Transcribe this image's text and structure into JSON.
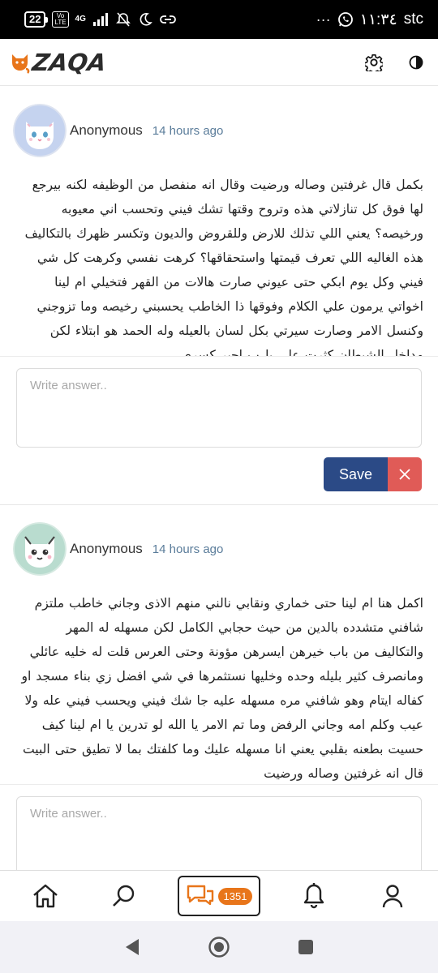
{
  "status_bar": {
    "battery": "22",
    "network": "4G",
    "time": "١١:٣٤",
    "carrier": "stc",
    "dots": "···"
  },
  "app": {
    "logo_text": "ZAQA",
    "brand_color": "#e8751a"
  },
  "posts": [
    {
      "author": "Anonymous",
      "time": "14 hours ago",
      "body": "بكمل قال غرفتين وصاله ورضيت وقال انه منفصل من الوظيفه لكنه بيرجع لها فوق كل تنازلاتي هذه وتروح وقتها تشك فيني وتحسب اني معيوبه ورخيصه؟ يعني اللي تذلك للارض وللقروض والديون وتكسر ظهرك بالتكاليف هذه الغاليه اللي تعرف قيمتها واستحقاقها؟ كرهت نفسي وكرهت كل شي فيني وكل يوم ابكي حتى عيوني صارت هالات من القهر فتخيلي ام لينا اخواتي يرمون علي الكلام وفوقها ذا الخاطب يحسبني رخيصه وما تزوجني وكنسل الامر وصارت سيرتي بكل لسان بالعيله وله الحمد هو ابتلاء لكن مداخل الشيطان كثرت علي يارب اجبر كسري",
      "answer_placeholder": "Write answer..",
      "save_label": "Save"
    },
    {
      "author": "Anonymous",
      "time": "14 hours ago",
      "body": "اكمل هنا ام لينا حتى خماري ونقابي نالني منهم الاذى وجاني خاطب ملتزم شافني متشدده بالدين من حيث حجابي الكامل لكن مسهله له المهر والتكاليف من باب خيرهن ايسرهن مؤونة وحتى العرس قلت له خليه عائلي ومانصرف كثير بليله وحده وخليها نستثمرها في شي افضل زي بناء مسجد او كفاله ايتام وهو شافني مره مسهله عليه جا شك فيني ويحسب فيني عله ولا عيب وكلم امه وجاني الرفض وما تم الامر يا الله لو تدرين يا ام لينا كيف حسيت بطعنه بقلبي يعني انا مسهله عليك وما كلفتك بما لا تطيق حتى البيت قال انه غرفتين وصاله ورضيت",
      "answer_placeholder": "Write answer.."
    }
  ],
  "bottom_nav": {
    "badge_count": "1351",
    "items": [
      "home-icon",
      "search-icon",
      "chat-icon",
      "bell-icon",
      "user-icon"
    ]
  }
}
